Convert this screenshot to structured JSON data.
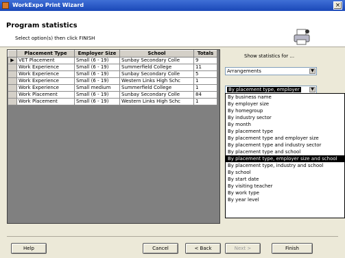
{
  "window": {
    "title": "WorkExpo Print Wizard",
    "close_glyph": "×"
  },
  "header": {
    "heading": "Program statistics",
    "subheading": "Select option(s) then click FINISH"
  },
  "grid": {
    "columns": [
      "Placement Type",
      "Employer Size",
      "School",
      "Totals"
    ],
    "current_row_marker": "▶",
    "rows": [
      [
        "VET Placement",
        "Small (6 - 19)",
        "Sunbay Secondary Colle",
        "9"
      ],
      [
        "Work Experience",
        "Small (6 - 19)",
        "Summerfield College",
        "11"
      ],
      [
        "Work Experience",
        "Small (6 - 19)",
        "Sunbay Secondary Colle",
        "5"
      ],
      [
        "Work Experience",
        "Small (6 - 19)",
        "Western Links High Schc",
        "1"
      ],
      [
        "Work Experience",
        "Small medium",
        "Summerfield College",
        "1"
      ],
      [
        "Work Placement",
        "Small (6 - 19)",
        "Sunbay Secondary Colle",
        "84"
      ],
      [
        "Work Placement",
        "Small (6 - 19)",
        "Western Links High Schc",
        "1"
      ]
    ]
  },
  "stats": {
    "label": "Show statistics for ...",
    "arrangements_value": "Arrangements",
    "breakdown_value": "By placement type, employer",
    "dropdown_arrow": "▼",
    "options": [
      "By business name",
      "By employer size",
      "By homegroup",
      "By industry sector",
      "By month",
      "By placement type",
      "By placement type and employer size",
      "By placement type and industry sector",
      "By placement type and school",
      "By placement type, employer size and school",
      "By placement type, industry and school",
      "By school",
      "By start date",
      "By visiting teacher",
      "By work type",
      "By year level"
    ],
    "selected_index": 9
  },
  "buttons": {
    "help": "Help",
    "cancel": "Cancel",
    "back": "< Back",
    "next": "Next >",
    "finish": "Finish"
  }
}
